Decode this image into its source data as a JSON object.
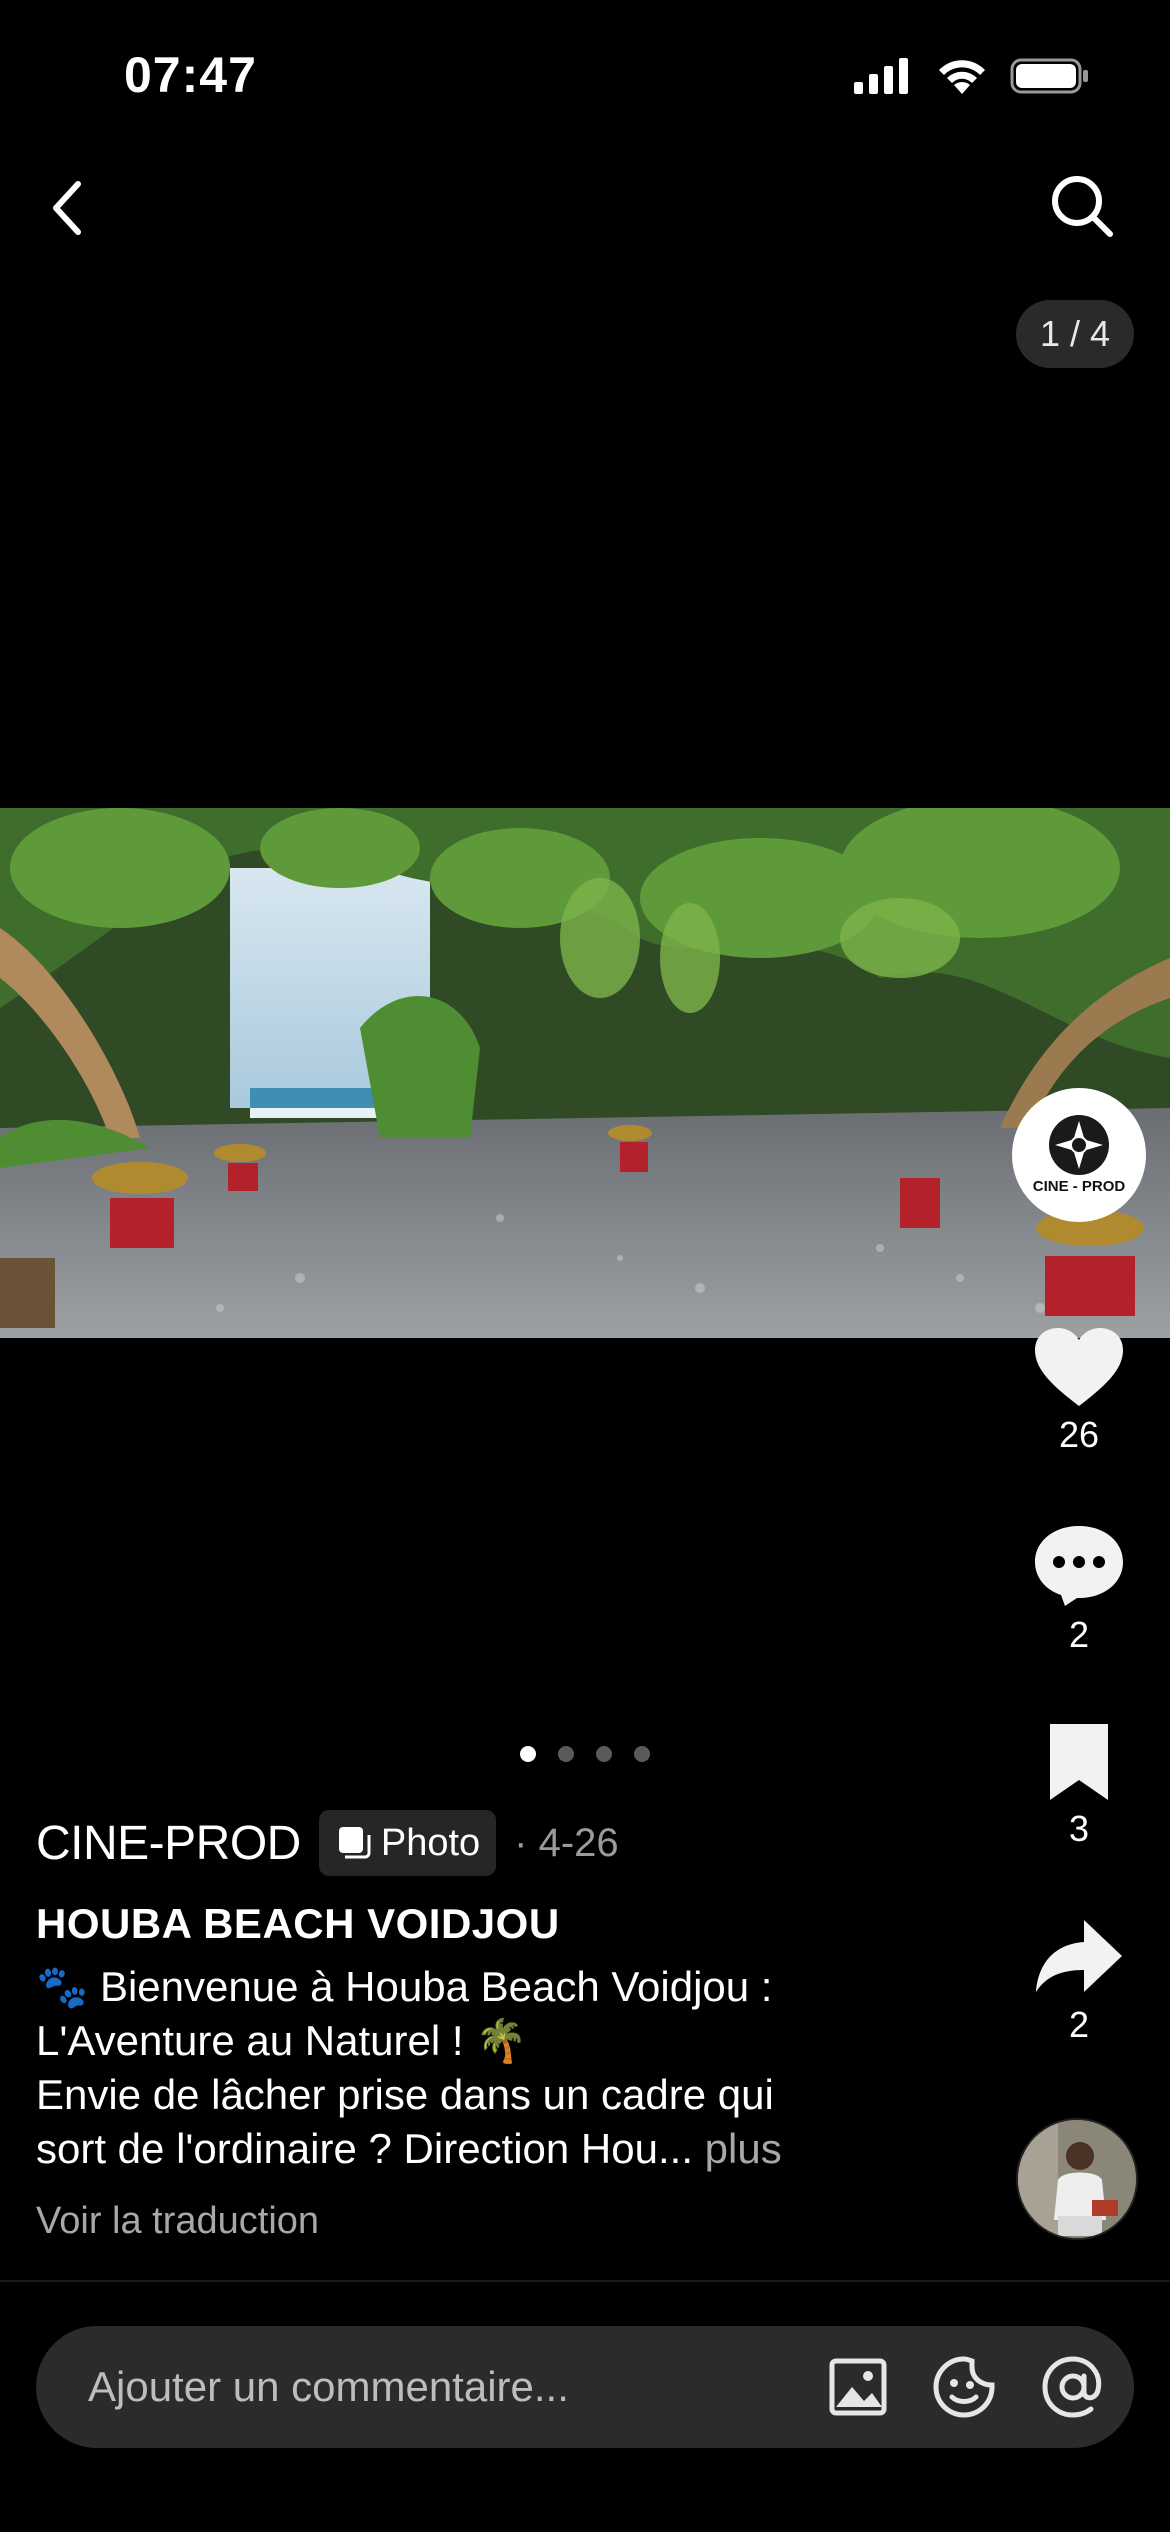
{
  "status_bar": {
    "time": "07:47"
  },
  "header": {
    "back_icon": "chevron-left-icon",
    "search_icon": "search-icon",
    "page_counter": "1 / 4"
  },
  "carousel": {
    "total": 4,
    "active_index": 0
  },
  "author": {
    "name": "CINE-PROD",
    "avatar_text": "CINE - PROD",
    "badge_label": "Photo",
    "date": "· 4-26"
  },
  "actions": {
    "likes": "26",
    "comments": "2",
    "saves": "3",
    "shares": "2"
  },
  "post": {
    "title": "HOUBA BEACH VOIDJOU",
    "caption_line1_emoji": "🐾",
    "caption_line1": " Bienvenue à Houba Beach Voidjou :",
    "caption_line2": "L'Aventure au Naturel ! ",
    "caption_line2_emoji": "🌴",
    "caption_line3": "Envie de lâcher prise dans un cadre qui",
    "caption_line4": "sort de l'ordinaire ? Direction Hou... ",
    "more_label": "plus",
    "translate_label": "Voir la traduction"
  },
  "comment_bar": {
    "placeholder": "Ajouter un commentaire...",
    "icons": [
      "image-icon",
      "sticker-icon",
      "mention-icon"
    ]
  },
  "colors": {
    "background": "#000000",
    "muted_text": "#a8a8a8",
    "chip_bg": "#262626"
  }
}
